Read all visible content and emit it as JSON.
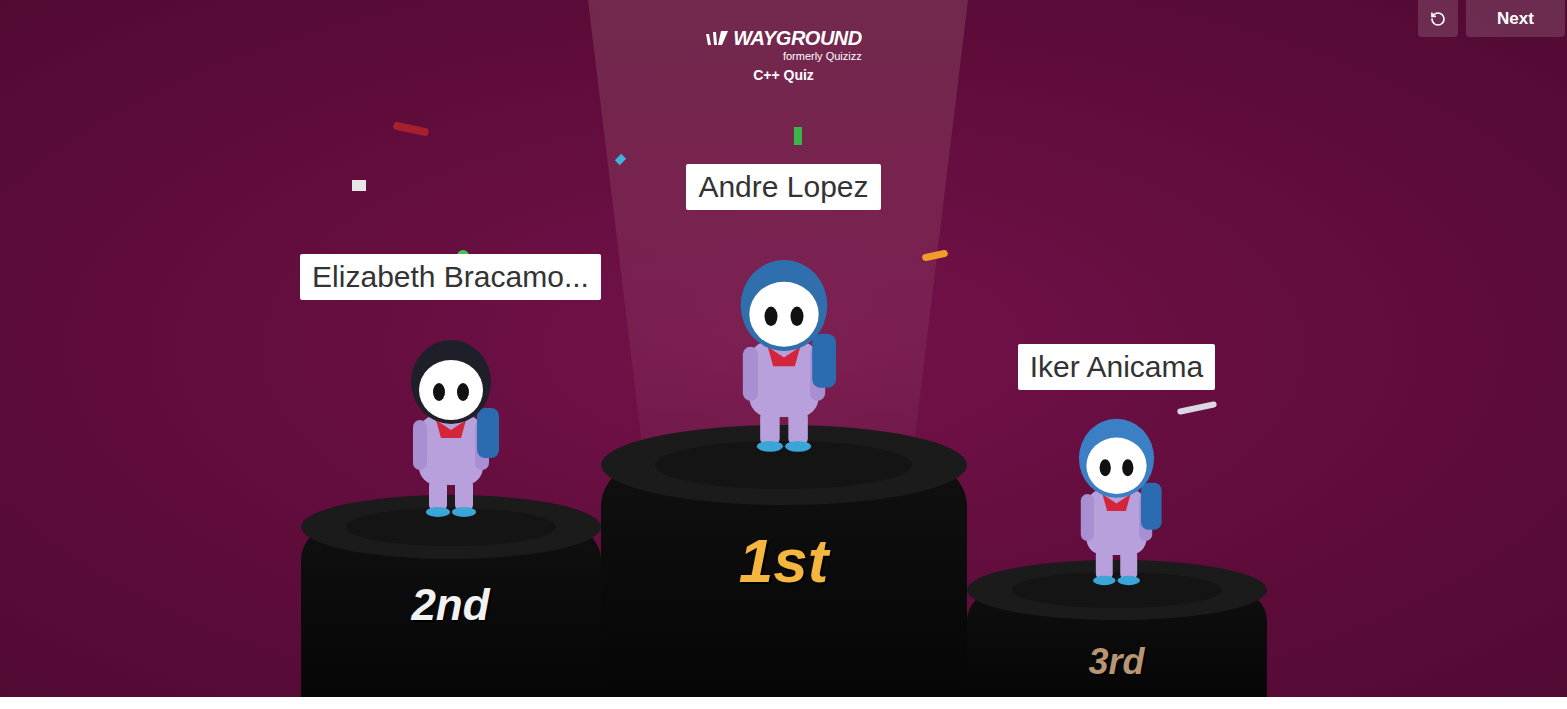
{
  "header": {
    "logo": "WAYGROUND",
    "subtitle": "formerly Quizizz",
    "quiz_title": "C++ Quiz"
  },
  "controls": {
    "next_button": "Next"
  },
  "podium": [
    {
      "name": "Elizabeth Bracamo...",
      "rank": "2nd",
      "kind": "second",
      "color": "#1f1f2a"
    },
    {
      "name": "Andre Lopez",
      "rank": "1st",
      "kind": "first",
      "color": "#2f6fae"
    },
    {
      "name": "Iker Anicama",
      "rank": "3rd",
      "kind": "third",
      "color": "#3b7fc4"
    }
  ]
}
